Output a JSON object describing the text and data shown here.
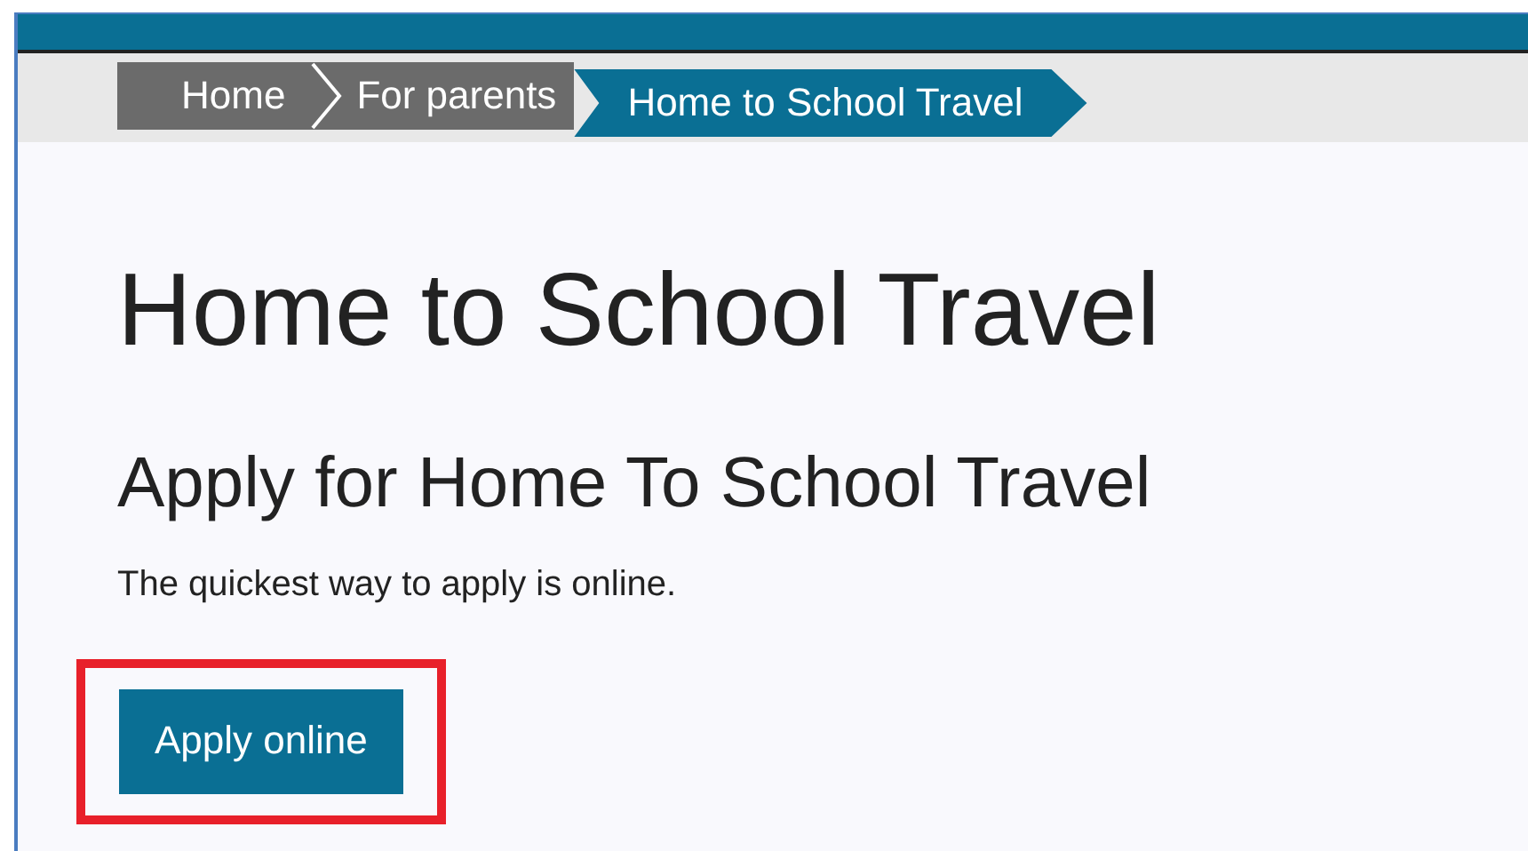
{
  "breadcrumb": [
    {
      "label": "Home",
      "selected": false
    },
    {
      "label": "For parents",
      "selected": false
    },
    {
      "label": "Home to School Travel",
      "selected": true
    }
  ],
  "title": "Home to School Travel",
  "section": {
    "heading": "Apply for Home To School Travel",
    "text": "The quickest way to apply is online.",
    "button": {
      "label": "Apply online",
      "highlighted": true
    }
  }
}
